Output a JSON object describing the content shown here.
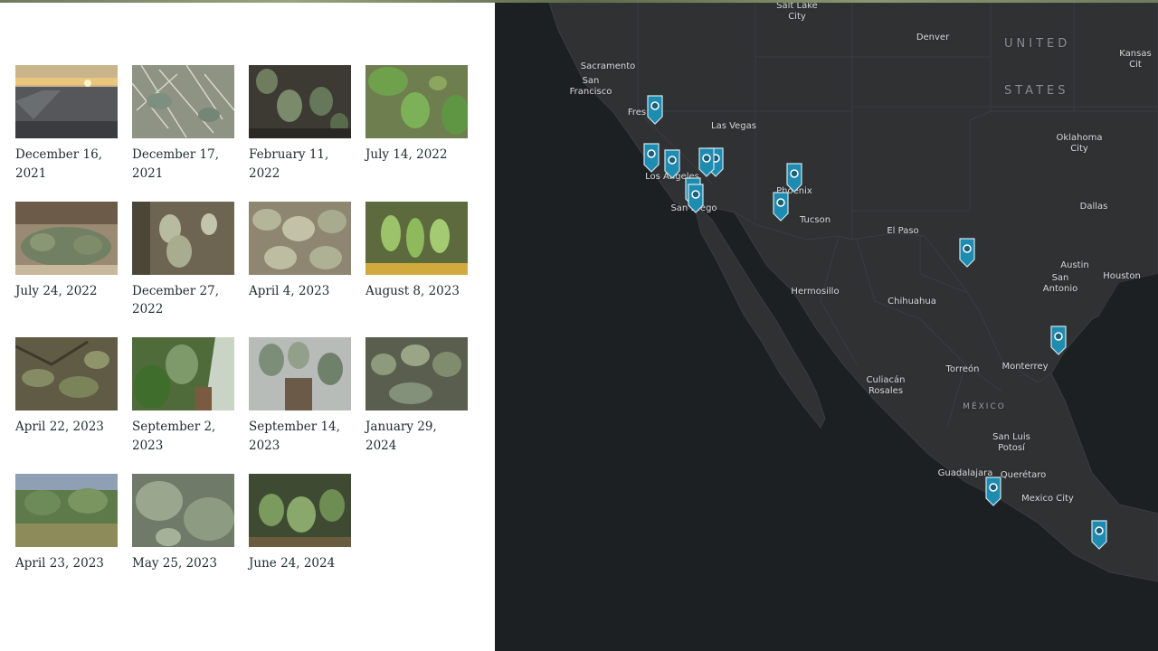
{
  "gallery": {
    "items": [
      {
        "date": "December 16, 2021",
        "thumb": "road-sunset"
      },
      {
        "date": "December 17, 2021",
        "thumb": "dry-cactus"
      },
      {
        "date": "February 11, 2022",
        "thumb": "prickly-pear-dark"
      },
      {
        "date": "July 14, 2022",
        "thumb": "green-pads"
      },
      {
        "date": "July 24, 2022",
        "thumb": "sprawling-cactus"
      },
      {
        "date": "December 27, 2022",
        "thumb": "fuzzy-pads"
      },
      {
        "date": "April 4, 2023",
        "thumb": "pale-pads"
      },
      {
        "date": "August 8, 2023",
        "thumb": "bright-pads"
      },
      {
        "date": "April 22, 2023",
        "thumb": "fallen-pads"
      },
      {
        "date": "September 2, 2023",
        "thumb": "sidewalk-cactus"
      },
      {
        "date": "September 14, 2023",
        "thumb": "tall-cactus"
      },
      {
        "date": "January 29, 2024",
        "thumb": "cactus-patch"
      },
      {
        "date": "April 23, 2023",
        "thumb": "hedge-cactus"
      },
      {
        "date": "May 25, 2023",
        "thumb": "closeup-pads"
      },
      {
        "date": "June 24, 2024",
        "thumb": "garden-cactus"
      }
    ]
  },
  "map": {
    "country_labels": {
      "usa_line1": "UNITED",
      "usa_line2": "STATES",
      "mexico": "MÉXICO"
    },
    "cities": {
      "salt_lake": "Salt Lake\nCity",
      "denver": "Denver",
      "kansas_city": "Kansas Cit",
      "sacramento": "Sacramento",
      "san_francisco": "San\nFrancisco",
      "fresno": "Fres",
      "las_vegas": "Las Vegas",
      "oklahoma": "Oklahoma\nCity",
      "los_angeles": "Los Angeles",
      "phoenix": "Phoenix",
      "dallas": "Dallas",
      "san_diego": "San Diego",
      "tucson": "Tucson",
      "el_paso": "El Paso",
      "austin": "Austin",
      "san_antonio": "San\nAntonio",
      "houston": "Houston",
      "hermosillo": "Hermosillo",
      "chihuahua": "Chihuahua",
      "monterrey": "Monterrey",
      "culiacan": "Culiacán\nRosales",
      "torreon": "Torreón",
      "san_luis": "San Luis\nPotosí",
      "guadalajara": "Guadalajara",
      "queretaro": "Querétaro",
      "mexico_city": "Mexico City"
    },
    "pin_color": "#1e8bb0",
    "pin_count": 13
  },
  "colors": {
    "water": "#1c2023",
    "land": "#2f3133",
    "border": "#3a3d40",
    "date_text": "#1f2a2c"
  }
}
